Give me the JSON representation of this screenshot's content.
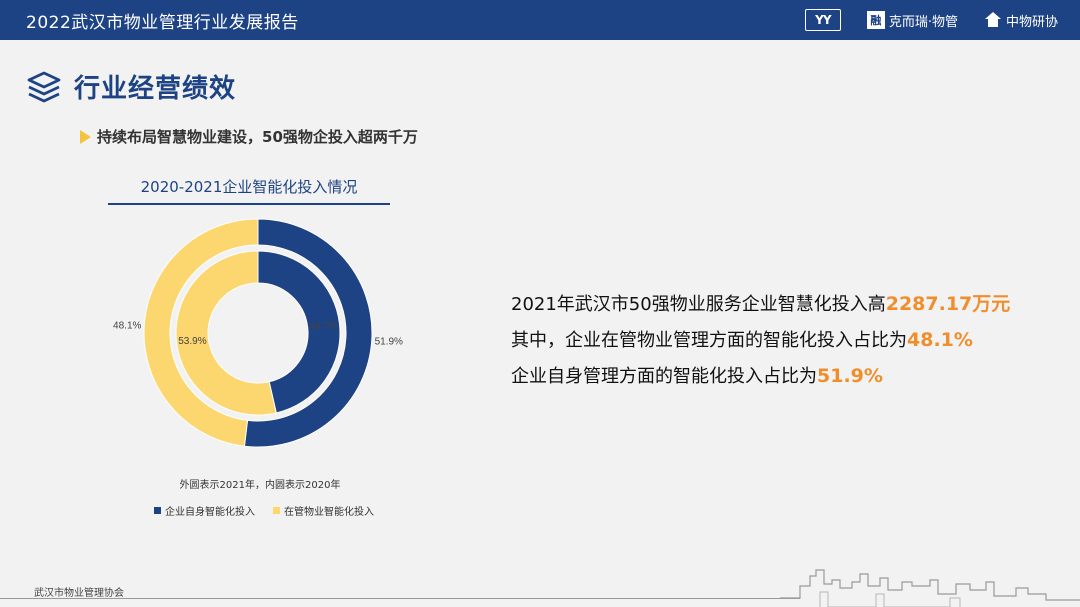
{
  "header": {
    "title": "2022武汉市物业管理行业发展报告",
    "logos": [
      "YY",
      "克而瑞·物管",
      "中物研协"
    ],
    "logo2_char": "融"
  },
  "section": {
    "title": "行业经营绩效"
  },
  "bullet": {
    "text": "持续布局智慧物业建设，50强物企投入超两千万"
  },
  "chart_data": {
    "type": "pie",
    "title": "2020-2021企业智能化投入情况",
    "note": "外圆表示2021年，内圆表示2020年",
    "categories": [
      "企业自身智能化投入",
      "在管物业智能化投入"
    ],
    "series": [
      {
        "values": [
          51.9,
          48.1
        ],
        "labels": [
          "51.9%",
          "48.1%"
        ]
      },
      {
        "values": [
          46.7,
          53.9
        ],
        "labels": [
          "46.7%",
          "53.9%"
        ]
      }
    ],
    "colors": [
      "#1e4384",
      "#fcd66e"
    ]
  },
  "stats": {
    "line1_prefix": "2021年武汉市50强物业服务企业智慧化投入高",
    "line1_value": "2287.17万元",
    "line2_prefix": "其中，企业在管物业管理方面的智能化投入占比为",
    "line2_value": "48.1%",
    "line3_prefix": "企业自身管理方面的智能化投入占比为",
    "line3_value": "51.9%"
  },
  "footer": {
    "text": "武汉市物业管理协会"
  }
}
